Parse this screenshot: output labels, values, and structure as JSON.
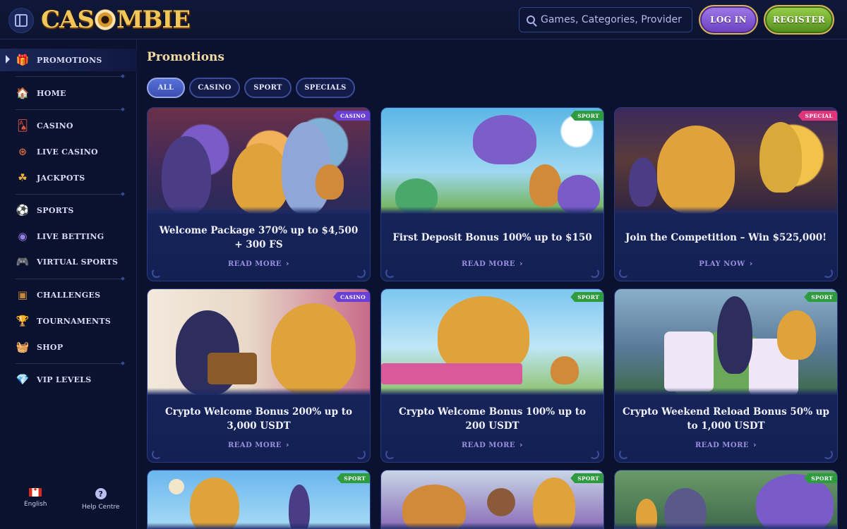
{
  "header": {
    "logo_text": "CASOMBIE",
    "search_placeholder": "Games, Categories, Providers",
    "login_label": "LOG IN",
    "register_label": "REGISTER"
  },
  "sidebar": {
    "items": [
      {
        "label": "PROMOTIONS",
        "icon": "gift-icon"
      },
      {
        "label": "HOME",
        "icon": "house-icon"
      },
      {
        "label": "CASINO",
        "icon": "cards-icon"
      },
      {
        "label": "LIVE CASINO",
        "icon": "roulette-icon"
      },
      {
        "label": "JACKPOTS",
        "icon": "clover-icon"
      },
      {
        "label": "SPORTS",
        "icon": "football-icon"
      },
      {
        "label": "LIVE BETTING",
        "icon": "live-ball-icon"
      },
      {
        "label": "VIRTUAL SPORTS",
        "icon": "gamepad-icon"
      },
      {
        "label": "CHALLENGES",
        "icon": "chest-icon"
      },
      {
        "label": "TOURNAMENTS",
        "icon": "trophy-icon"
      },
      {
        "label": "SHOP",
        "icon": "basket-icon"
      },
      {
        "label": "VIP LEVELS",
        "icon": "diamond-icon"
      }
    ],
    "footer": {
      "language_label": "English",
      "help_label": "Help Centre"
    }
  },
  "main": {
    "title": "Promotions",
    "tabs": [
      {
        "label": "ALL",
        "active": true
      },
      {
        "label": "CASINO",
        "active": false
      },
      {
        "label": "SPORT",
        "active": false
      },
      {
        "label": "SPECIALS",
        "active": false
      }
    ],
    "cards": [
      {
        "title": "Welcome Package 370% up to $4,500 + 300 FS",
        "cta": "READ MORE",
        "badge": "CASINO"
      },
      {
        "title": "First Deposit Bonus 100% up to $150",
        "cta": "READ MORE",
        "badge": "SPORT"
      },
      {
        "title": "Join the Competition – Win $525,000!",
        "cta": "PLAY NOW",
        "badge": "SPECIAL"
      },
      {
        "title": "Crypto Welcome Bonus 200% up to 3,000 USDT",
        "cta": "READ MORE",
        "badge": "CASINO"
      },
      {
        "title": "Crypto Welcome Bonus 100% up to 200 USDT",
        "cta": "READ MORE",
        "badge": "SPORT"
      },
      {
        "title": "Crypto Weekend Reload Bonus 50% up to 1,000 USDT",
        "cta": "READ MORE",
        "badge": "SPORT"
      },
      {
        "title": "",
        "cta": "",
        "badge": "SPORT"
      },
      {
        "title": "",
        "cta": "",
        "badge": "SPORT"
      },
      {
        "title": "",
        "cta": "",
        "badge": "SPORT"
      }
    ]
  },
  "colors": {
    "background": "#0b1230",
    "accent_gold": "#f1d9a3",
    "casino_badge": "#6a3fd6",
    "sport_badge": "#2e9b3f",
    "special_badge": "#e0347b"
  }
}
